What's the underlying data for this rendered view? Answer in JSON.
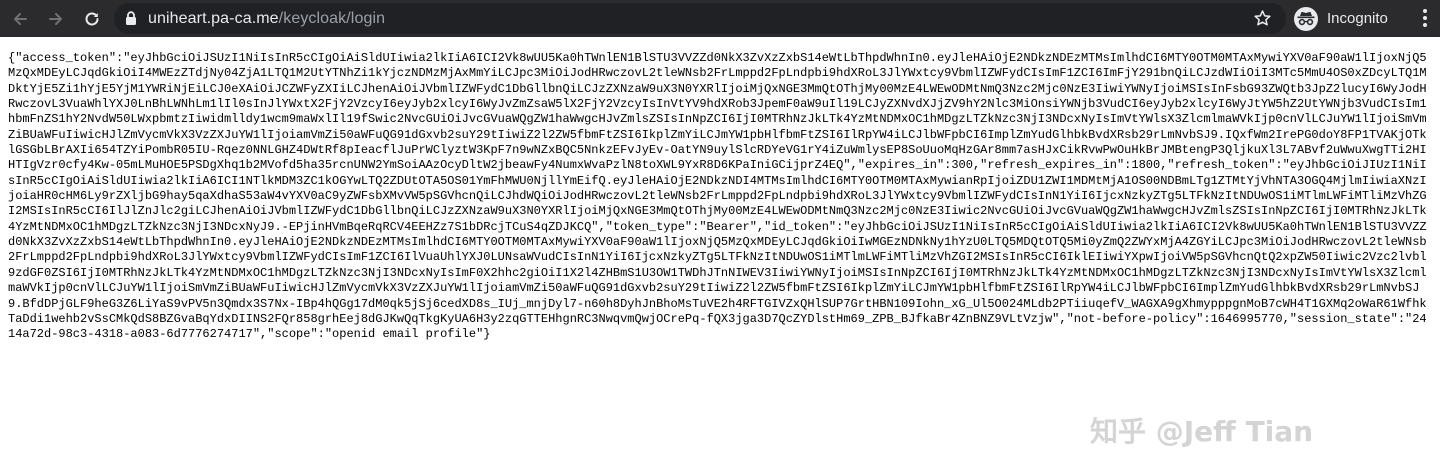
{
  "browser": {
    "url_host": "uniheart.pa-ca.me",
    "url_path": "/keycloak/login",
    "incognito_label": "Incognito",
    "icons": {
      "back": "arrow-left-icon",
      "forward": "arrow-right-icon",
      "reload": "reload-icon",
      "lock": "lock-icon",
      "bookmark": "star-icon",
      "incognito": "incognito-icon",
      "menu": "kebab-menu-icon"
    },
    "colors": {
      "toolbar": "#2b2b2d",
      "omnibox": "#202124",
      "text": "#e8eaed",
      "path": "#9aa0a6"
    }
  },
  "page": {
    "json_body": "{\"access_token\":\"eyJhbGciOiJSUzI1NiIsInR5cCIgOiAiSldUIiwia2lkIiA6ICI2Vk8wUU5Ka0hTWnlEN1BlSTU3VVZZd0NkX3ZvXzZxbS14eWtLbThpdWhnIn0.eyJleHAiOjE2NDkzNDEzMTMsImlhdCI6MTY0OTM0MTAxMywiYXV0aF90aW1lIjoxNjQ5MzQxMDEyLCJqdGkiOiI4MWEzZTdjNy04ZjA1LTQ1M2UtYTNhZi1kYjczNDMzMjAxMmYiLCJpc3MiOiJodHRwczovL2tleWNsb2FrLmppd2FpLndpbi9hdXRoL3JlYWxtcy9VbmlIZWFydCIsImF1ZCI6ImFjY291bnQiLCJzdWIiOiI3MTc5MmU4OS0xZDcyLTQ1MDktYjE5Zi1hYjE5YjM1YWRiNjEiLCJ0eXAiOiJCZWFyZXIiLCJhenAiOiJVbmlIZWFydC1DbGllbnQiLCJzZXNzaW9uX3N0YXRlIjoiMjQxNGE3MmQtOThjMy00MzE4LWEwODMtNmQ3Nzc2Mjc0NzE3IiwiYWNyIjoiMSIsInFsbG93ZWQtb3JpZ2lucyI6WyJodHRwczovL3VuaWhlYXJ0LnBhLWNhLm1lIl0sInJlYWxtX2FjY2VzcyI6eyJyb2xlcyI6WyJvZmZsaW5lX2FjY2VzcyIsInVtYV9hdXRob3JpemF0aW9uIl19LCJyZXNvdXJjZV9hY2Nlc3MiOnsiYWNjb3VudCI6eyJyb2xlcyI6WyJtYW5hZ2UtYWNjb3VudCIsIm1hbmFnZS1hY2NvdW50LWxpbmtzIiwidmlldy1wcm9maWxlIl19fSwic2NvcGUiOiJvcGVuaWQgZW1haWwgcHJvZmlsZSIsInNpZCI6IjI0MTRhNzJkLTk4YzMtNDMxOC1hMDgzLTZkNzc3NjI3NDcxNyIsImVtYWlsX3ZlcmlmaWVkIjp0cnVlLCJuYW1lIjoiSmVmZiBUaWFuIiwicHJlZmVycmVkX3VzZXJuYW1lIjoiamVmZi50aWFuQG91dGxvb2suY29tIiwiZ2l2ZW5fbmFtZSI6IkplZmYiLCJmYW1pbHlfbmFtZSI6IlRpYW4iLCJlbWFpbCI6ImplZmYudGlhbkBvdXRsb29rLmNvbSJ9.IQxfWm2IrePG0doY8FP1TVAKjOTklGSGbLBrAXIi654TZYiPombR05IU-Rqez0NNLGHZ4DWtRf8pIeacflJuPrWClyztW3KpF7n9wNZxBQC5NnkzEFvJyEv-OatYN9uylSlcRDYeVG1rY4iZuWmlysEP8SoUuoMqHzGAr8mm7asHJxCikRvwPwOuHkBrJMBtengP3QljkuXl3L7ABvf2uWwuXwgTTi2HIHTIgVzr0cfy4Kw-05mLMuHOE5PSDgXhq1b2MVofd5ha35rcnUNW2YmSoiAAzOcyDltW2jbeawFy4NumxWvaPzlN8toXWL9YxR8D6KPaIniGCijprZ4EQ\",\"expires_in\":300,\"refresh_expires_in\":1800,\"refresh_token\":\"eyJhbGciOiJIUzI1NiIsInR5cCIgOiAiSldUIiwia2lkIiA6ICI1NTlkMDM3ZC1kOGYwLTQ2ZDUtOTA5OS01YmFhMWU0NjllYmEifQ.eyJleHAiOjE2NDkzNDI4MTMsImlhdCI6MTY0OTM0MTAxMywianRpIjoiZDU1ZWI1MDMtMjA1OS00NDBmLTg1ZTMtYjVhNTA3OGQ4MjlmIiwiaXNzIjoiaHR0cHM6Ly9rZXljbG9hay5qaXdhaS53aW4vYXV0aC9yZWFsbXMvVW5pSGVhcnQiLCJhdWQiOiJodHRwczovL2tleWNsb2FrLmppd2FpLndpbi9hdXRoL3JlYWxtcy9VbmlIZWFydCIsInN1YiI6IjcxNzkyZTg5LTFkNzItNDUwOS1iMTlmLWFiMTliMzVhZGI2MSIsInR5cCI6IlJlZnJlc2giLCJhenAiOiJVbmlIZWFydC1DbGllbnQiLCJzZXNzaW9uX3N0YXRlIjoiMjQxNGE3MmQtOThjMy00MzE4LWEwODMtNmQ3Nzc2Mjc0NzE3Iiwic2NvcGUiOiJvcGVuaWQgZW1haWwgcHJvZmlsZSIsInNpZCI6IjI0MTRhNzJkLTk4YzMtNDMxOC1hMDgzLTZkNzc3NjI3NDcxNyJ9.-EPjinHVmBqeRqRCV4EEHZz7S1bDRcjTCuS4qZDJKCQ\",\"token_type\":\"Bearer\",\"id_token\":\"eyJhbGciOiJSUzI1NiIsInR5cCIgOiAiSldUIiwia2lkIiA6ICI2Vk8wUU5Ka0hTWnlEN1BlSTU3VVZZd0NkX3ZvXzZxbS14eWtLbThpdWhnIn0.eyJleHAiOjE2NDkzNDEzMTMsImlhdCI6MTY0OTM0MTAxMywiYXV0aF90aW1lIjoxNjQ5MzQxMDEyLCJqdGkiOiIwMGEzNDNkNy1hYzU0LTQ5MDQtOTQ5Mi0yZmQ2ZWYxMjA4ZGYiLCJpc3MiOiJodHRwczovL2tleWNsb2FrLmppd2FpLndpbi9hdXRoL3JlYWxtcy9VbmlIZWFydCIsImF1ZCI6IlVuaUhlYXJ0LUNsaWVudCIsInN1YiI6IjcxNzkyZTg5LTFkNzItNDUwOS1iMTlmLWFiMTliMzVhZGI2MSIsInR5cCI6IklEIiwiYXpwIjoiVW5pSGVhcnQtQ2xpZW50Iiwic2Vzc2lvbl9zdGF0ZSI6IjI0MTRhNzJkLTk4YzMtNDMxOC1hMDgzLTZkNzc3NjI3NDcxNyIsImF0X2hhc2giOiI1X2l4ZHBmS1U3OW1TWDhJTnNIWEV3IiwiYWNyIjoiMSIsInNpZCI6IjI0MTRhNzJkLTk4YzMtNDMxOC1hMDgzLTZkNzc3NjI3NDcxNyIsImVtYWlsX3ZlcmlmaWVkIjp0cnVlLCJuYW1lIjoiSmVmZiBUaWFuIiwicHJlZmVycmVkX3VzZXJuYW1lIjoiamVmZi50aWFuQG91dGxvb2suY29tIiwiZ2l2ZW5fbmFtZSI6IkplZmYiLCJmYW1pbHlfbmFtZSI6IlRpYW4iLCJlbWFpbCI6ImplZmYudGlhbkBvdXRsb29rLmNvbSJ9.BfdDPjGLF9heG3Z6LiYaS9vPV5n3Qmdx3S7Nx-IBp4hQGg17dM0qk5jSj6cedXD8s_IUj_mnjDyl7-n60h8DyhJnBhoMsTuVE2h4RFTGIVZxQHlSUP7GrtHBN109Iohn_xG_Ul5O024MLdb2PTiiuqefV_WAGXA9gXhmypppgnMoB7cWH4T1GXMq2oWaR61WfhkTaDdi1wehb2vSsCMkQdS8BZGvaBqYdxDIINS2FQr858grhEej8dGJKwQqTkgKyUA6H3y2zqGTTEHhgnRC3NwqvmQwjOCrePq-fQX3jga3D7QcZYDlstHm69_ZPB_BJfkaBr4ZnBNZ9VLtVzjw\",\"not-before-policy\":1646995770,\"session_state\":\"2414a72d-98c3-4318-a083-6d7776274717\",\"scope\":\"openid email profile\"}",
    "watermark_text": "知乎 @Jeff Tian"
  }
}
